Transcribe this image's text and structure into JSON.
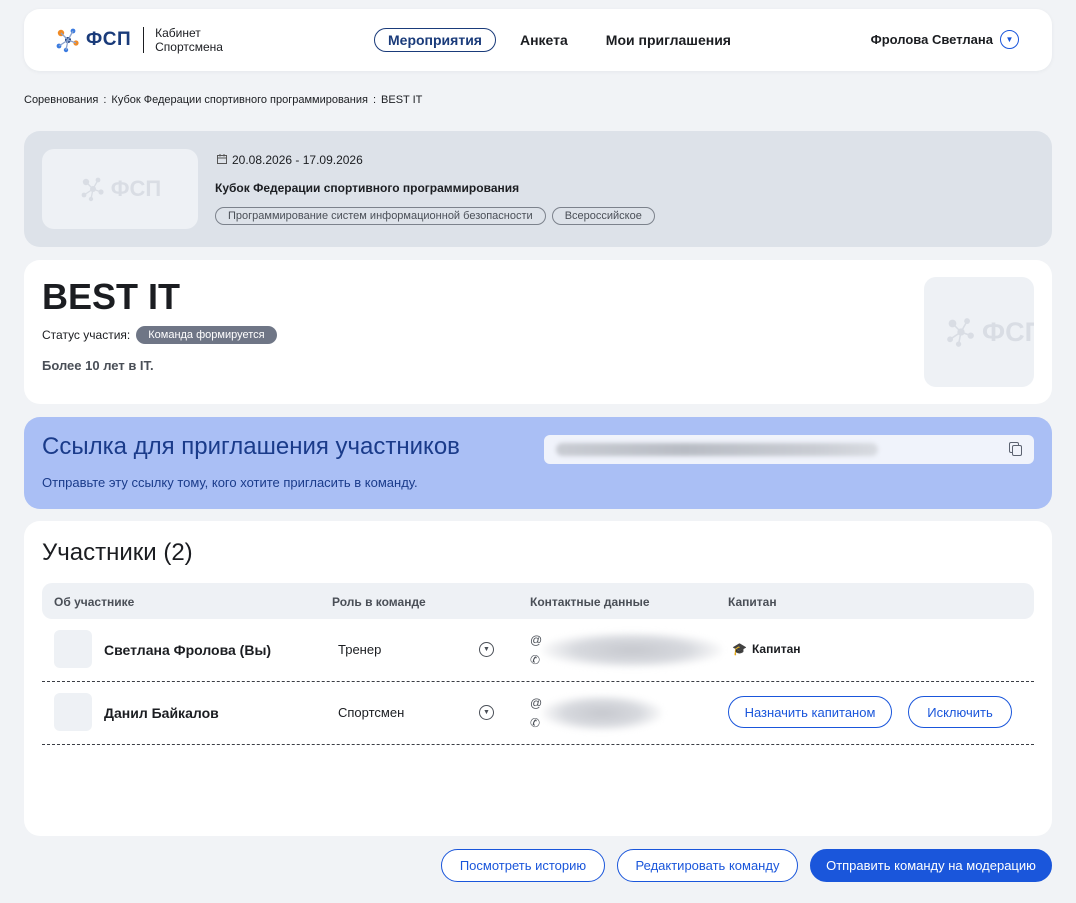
{
  "header": {
    "logo_text": "ФСП",
    "logo_caption_line1": "Кабинет",
    "logo_caption_line2": "Спортсмена",
    "nav": [
      {
        "label": "Мероприятия",
        "active": true
      },
      {
        "label": "Анкета",
        "active": false
      },
      {
        "label": "Мои приглашения",
        "active": false
      }
    ],
    "user_name": "Фролова Светлана"
  },
  "breadcrumb": [
    "Соревнования",
    "Кубок Федерации спортивного программирования",
    "BEST IT"
  ],
  "breadcrumb_sep": ":",
  "event": {
    "dates": "20.08.2026 - 17.09.2026",
    "title": "Кубок Федерации спортивного программирования",
    "tags": [
      "Программирование систем информационной безопасности",
      "Всероссийское"
    ]
  },
  "team": {
    "name": "BEST IT",
    "status_label": "Статус участия:",
    "status_value": "Команда формируется",
    "description": "Более 10 лет в IT."
  },
  "invite": {
    "title": "Ссылка для приглашения участников",
    "subtitle": "Отправьте эту ссылку тому, кого хотите пригласить в команду."
  },
  "participants": {
    "title": "Участники (2)",
    "columns": [
      "Об участнике",
      "Роль в команде",
      "Контактные данные",
      "Капитан"
    ],
    "rows": [
      {
        "name": "Светлана Фролова (Вы)",
        "role": "Тренер",
        "captain": "Капитан"
      },
      {
        "name": "Данил Байкалов",
        "role": "Спортсмен",
        "make_captain": "Назначить капитаном",
        "exclude": "Исключить"
      }
    ]
  },
  "actions": {
    "history": "Посмотреть историю",
    "edit": "Редактировать команду",
    "submit": "Отправить команду на модерацию"
  },
  "colors": {
    "accent": "#1a56db",
    "brand_dark": "#1a3b7a",
    "invite_bg": "#aabff5",
    "event_bg": "#dde2e9",
    "status_badge": "#6f7686"
  },
  "icons": [
    "fsp-logo-icon",
    "chevron-down-icon",
    "calendar-icon",
    "copy-icon",
    "at-icon",
    "phone-icon",
    "graduation-cap-icon"
  ]
}
